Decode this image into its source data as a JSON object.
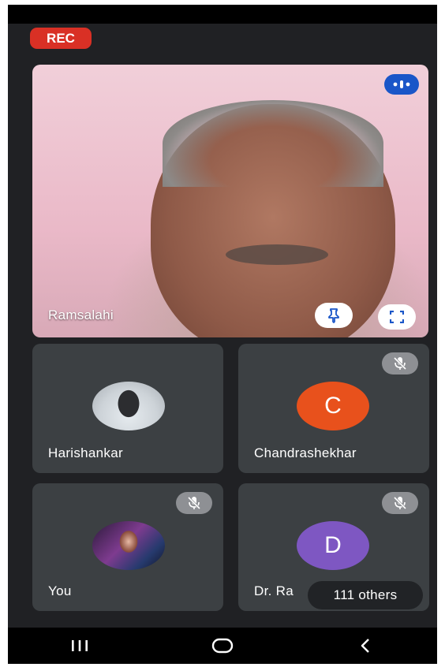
{
  "recording": {
    "label": "REC",
    "color": "#d93025"
  },
  "main_participant": {
    "name": "Ramsalahi",
    "audio_icon": "audio-level-icon",
    "pin_icon": "pin-icon",
    "fullscreen_icon": "fullscreen-icon"
  },
  "participants": [
    {
      "name": "Harishankar",
      "avatar": "photo",
      "muted": false
    },
    {
      "name": "Chandrashekhar",
      "avatar_letter": "C",
      "avatar_color": "#e8511c",
      "muted": true
    },
    {
      "name": "You",
      "avatar": "photo",
      "muted": true
    },
    {
      "name": "Dr. Ra",
      "avatar_letter": "D",
      "avatar_color": "#7e57c2",
      "muted": true
    }
  ],
  "others_count": "111 others",
  "navbar": {
    "recent_icon": "recent-apps-icon",
    "home_icon": "home-icon",
    "back_icon": "back-icon"
  }
}
